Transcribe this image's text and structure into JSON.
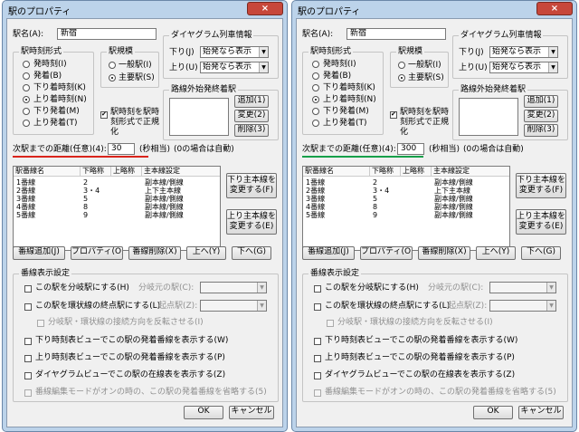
{
  "dialog": {
    "title": "駅のプロパティ",
    "close_symbol": "×",
    "station_name_label": "駅名(A):",
    "station_name_value": "新宿",
    "format_group": "駅時刻形式",
    "format_options": [
      "発時刻(I)",
      "発着(B)",
      "下り着時刻(K)",
      "上り着時刻(N)",
      "下り発着(M)",
      "上り発着(T)"
    ],
    "format_selected": 3,
    "scale_group": "駅規模",
    "scale_options": [
      "一般駅(I)",
      "主要駅(S)"
    ],
    "scale_selected": 1,
    "normalize_label": "駅時刻を駅時刻形式で正規化",
    "normalize_checked": true,
    "diagram_group": "ダイヤグラム列車情報",
    "down_label": "下り(J)",
    "down_value": "始発なら表示",
    "up_label": "上り(U)",
    "up_value": "始発なら表示",
    "outside_group": "路線外始発終着駅",
    "add_button": "追加(1)",
    "change_button": "変更(2)",
    "delete_button": "削除(3)",
    "distance_label": "次駅までの距離(任意)(4):",
    "distance_suffix": "(秒相当)",
    "distance_note": "(0の場合は自動)",
    "track_headers": [
      "駅番線名",
      "下略称",
      "上略称",
      "主本線設定"
    ],
    "track_rows": [
      [
        "1番線",
        "2",
        "",
        "副本線/側線"
      ],
      [
        "2番線",
        "3・4",
        "",
        "上下主本線"
      ],
      [
        "3番線",
        "5",
        "",
        "副本線/側線"
      ],
      [
        "4番線",
        "8",
        "",
        "副本線/側線"
      ],
      [
        "5番線",
        "9",
        "",
        "副本線/側線"
      ]
    ],
    "down_main_button": "下り主本線を変更する(F)",
    "up_main_button": "上り主本線を変更する(E)",
    "track_add_button": "番線追加(J)",
    "track_prop_button": "プロパティ(O)",
    "track_delete_button": "番線削除(X)",
    "move_up_button": "上へ(Y)",
    "move_down_button": "下へ(G)",
    "track_display_group": "番線表示設定",
    "branch_label": "この駅を分岐駅にする(H)",
    "branch_source_label": "分岐元の駅(C):",
    "loop_label": "この駅を環状線の終点駅にする(L)",
    "origin_label": "起点駅(Z):",
    "reverse_label": "分岐駅・環状線の接続方向を反転させる(I)",
    "down_view_label": "下り時刻表ビューでこの駅の発着番線を表示する(W)",
    "up_view_label": "上り時刻表ビューでこの駅の発着番線を表示する(P)",
    "diagram_view_label": "ダイヤグラムビューでこの駅の在線表を表示する(Z)",
    "edit_mode_label": "番線編集モードがオンの時の、この駅の発着番線を省略する(5)",
    "ok_button": "OK",
    "cancel_button": "キャンセル"
  },
  "panels": [
    {
      "distance_value": "30",
      "underline_color": "#d9251c"
    },
    {
      "distance_value": "300",
      "underline_color": "#14a04a"
    }
  ]
}
